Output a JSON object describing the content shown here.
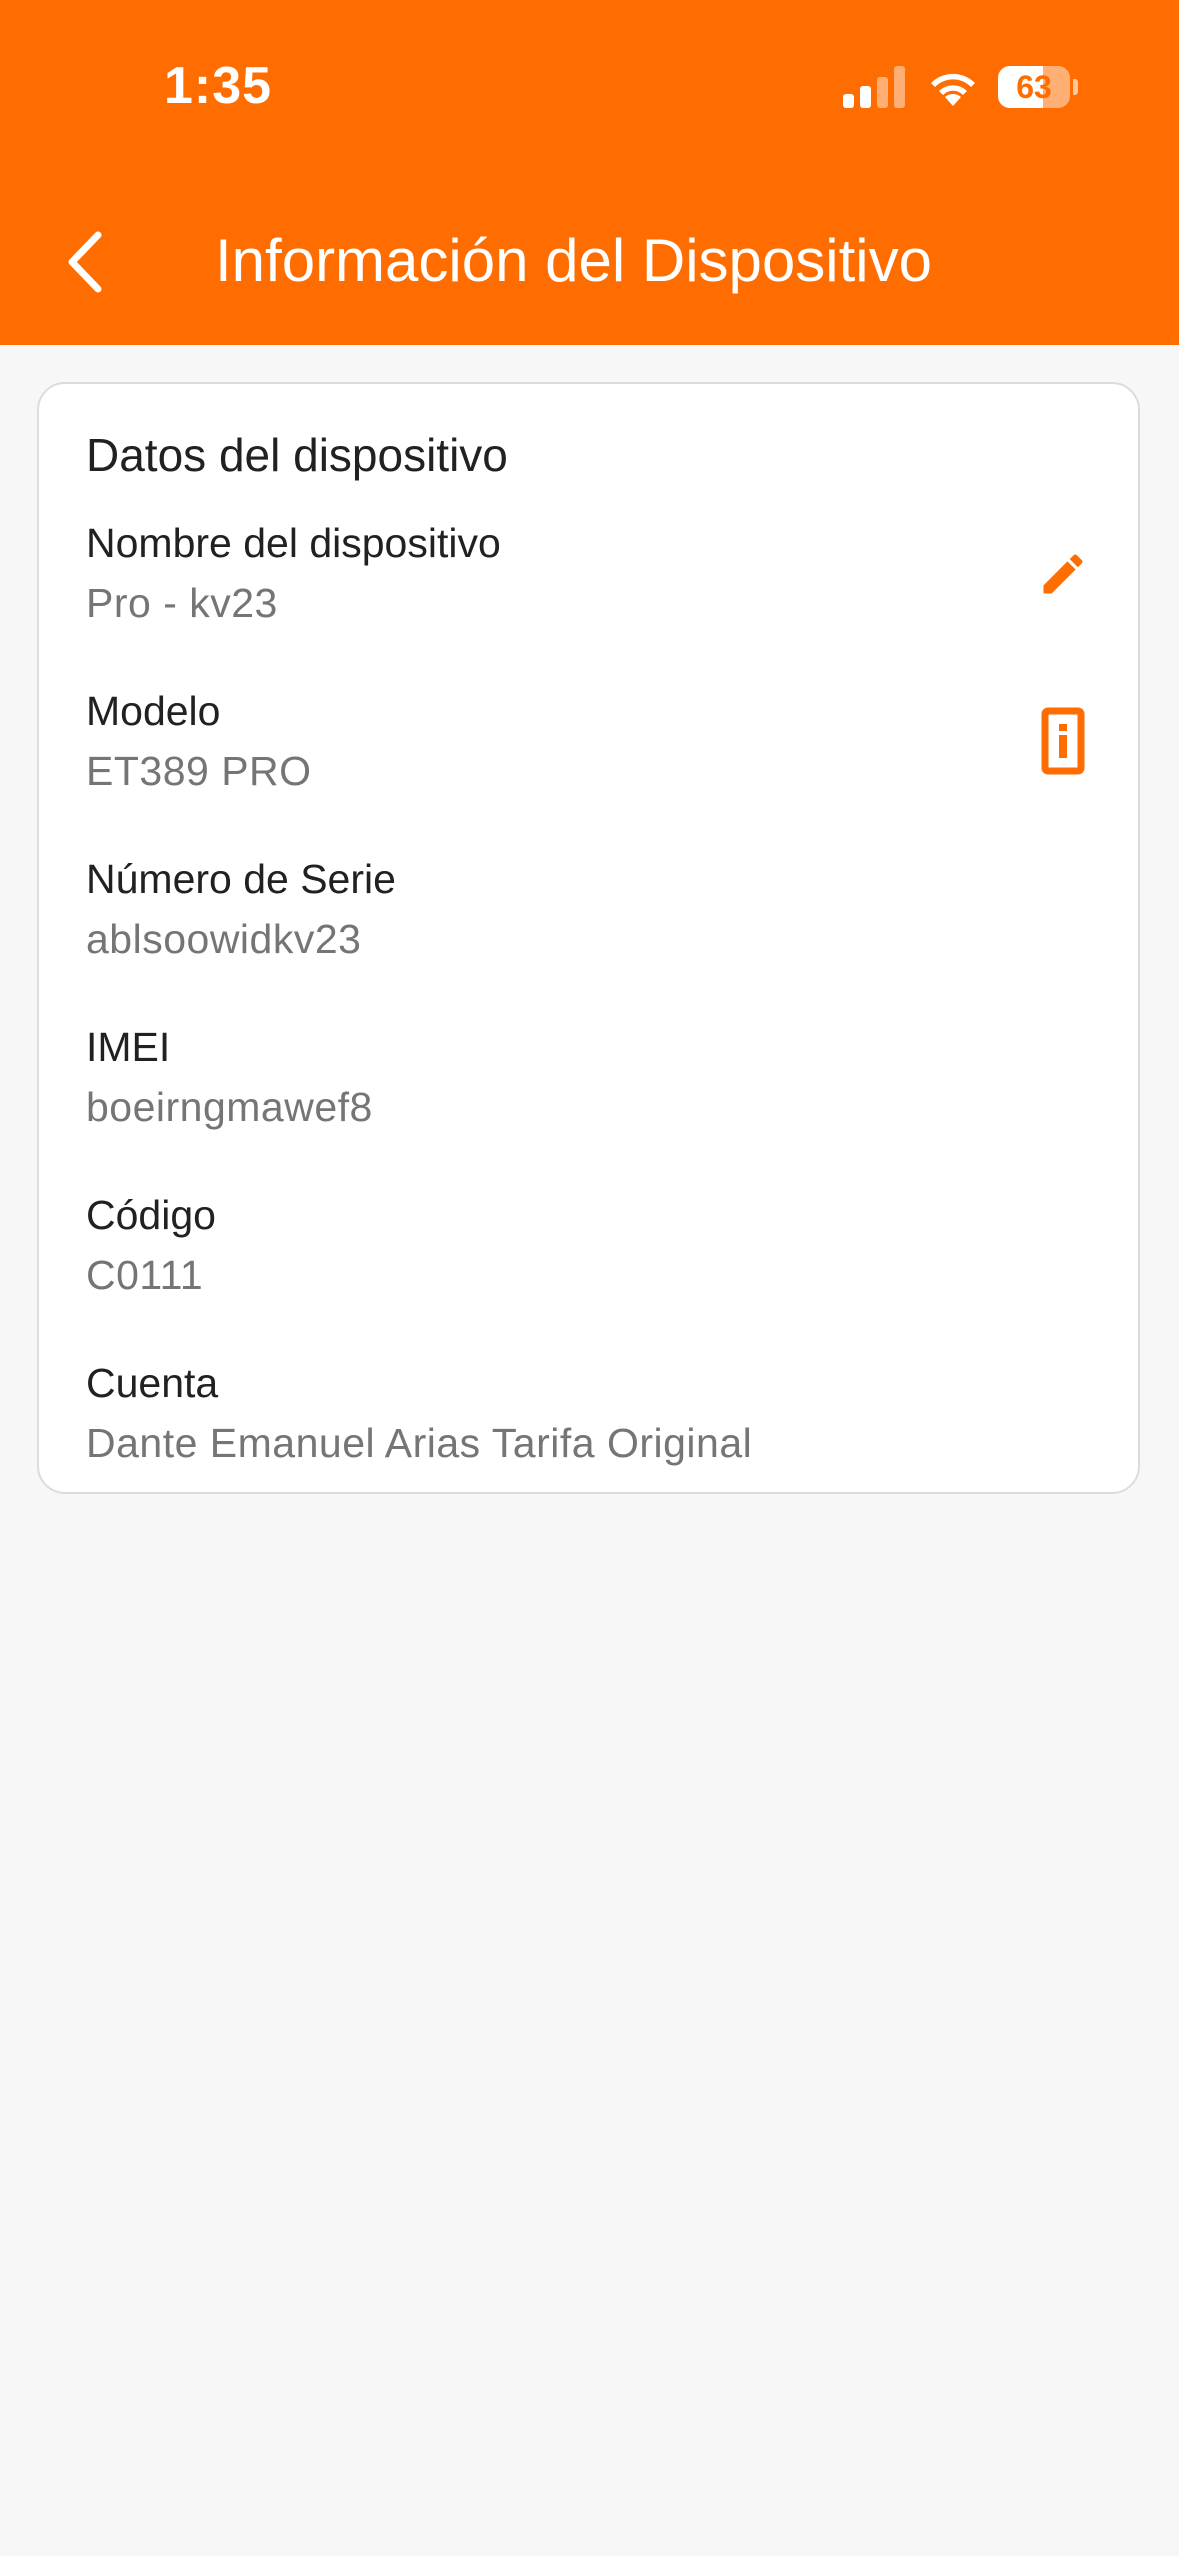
{
  "status_bar": {
    "time": "1:35",
    "battery_percent": "63",
    "battery_level": 0.63,
    "signal_bars_active": 2,
    "signal_bars_total": 4
  },
  "app_bar": {
    "title": "Información del Dispositivo",
    "back_icon": "chevron-left-icon"
  },
  "card": {
    "title": "Datos del dispositivo",
    "rows": [
      {
        "label": "Nombre del dispositivo",
        "value": "Pro - kv23",
        "icon": "pencil-icon"
      },
      {
        "label": "Modelo",
        "value": "ET389 PRO",
        "icon": "info-box-icon"
      },
      {
        "label": "Número de Serie",
        "value": "ablsoowidkv23"
      },
      {
        "label": "IMEI",
        "value": "boeirngmawef8"
      },
      {
        "label": "Código",
        "value": "C0111"
      },
      {
        "label": "Cuenta",
        "value": "Dante Emanuel Arias Tarifa Original"
      }
    ]
  },
  "colors": {
    "accent": "#ff6d00",
    "background": "#f7f7f7",
    "card": "#ffffff",
    "label": "#212121",
    "value": "#757575"
  }
}
